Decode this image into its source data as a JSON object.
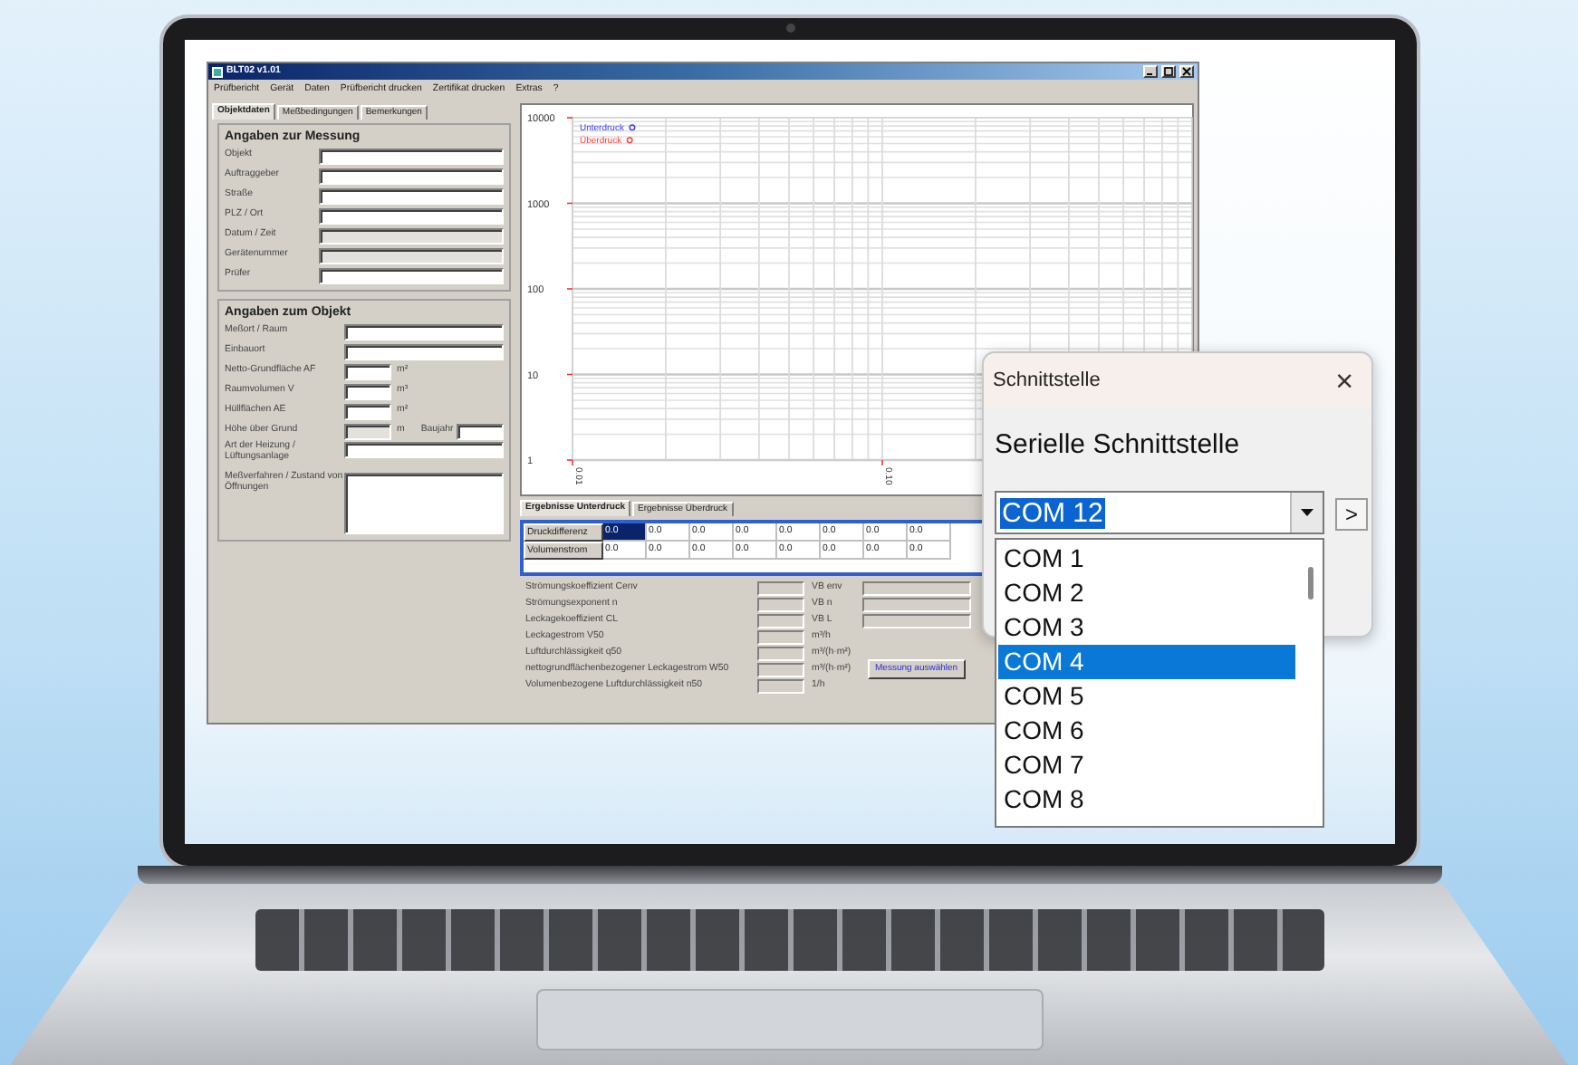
{
  "app": {
    "title": "BLT02 v1.01",
    "menu": [
      "Prüfbericht",
      "Gerät",
      "Daten",
      "Prüfbericht drucken",
      "Zertifikat drucken",
      "Extras",
      "?"
    ],
    "left_tabs": [
      {
        "label": "Objektdaten",
        "selected": true
      },
      {
        "label": "Meßbedingungen",
        "selected": false
      },
      {
        "label": "Bemerkungen",
        "selected": false
      }
    ],
    "groups": [
      {
        "title": "Angaben zur Messung",
        "fields": [
          {
            "kind": "text",
            "label": "Objekt",
            "disabled": false
          },
          {
            "kind": "text",
            "label": "Auftraggeber",
            "disabled": false
          },
          {
            "kind": "text",
            "label": "Straße",
            "disabled": false
          },
          {
            "kind": "text",
            "label": "PLZ / Ort",
            "disabled": false
          },
          {
            "kind": "text",
            "label": "Datum / Zeit",
            "disabled": true
          },
          {
            "kind": "text",
            "label": "Gerätenummer",
            "disabled": true
          },
          {
            "kind": "text",
            "label": "Prüfer",
            "disabled": false
          }
        ]
      },
      {
        "title": "Angaben zum Objekt",
        "fields": [
          {
            "kind": "text",
            "label": "Meßort / Raum",
            "disabled": false
          },
          {
            "kind": "text",
            "label": "Einbauort",
            "disabled": false
          },
          {
            "kind": "unit",
            "label": "Netto-Grundfläche AF",
            "unit": "m²",
            "disabled": false
          },
          {
            "kind": "unit",
            "label": "Raumvolumen V",
            "unit": "m³",
            "disabled": false
          },
          {
            "kind": "unit",
            "label": "Hüllflächen AE",
            "unit": "m²",
            "disabled": false
          },
          {
            "kind": "pair",
            "label": "Höhe über Grund",
            "unit": "m",
            "label2": "Baujahr",
            "disabled": true
          },
          {
            "kind": "text",
            "label": "Art der Heizung / Lüftungsanlage",
            "disabled": false
          },
          {
            "kind": "area",
            "label": "Meßverfahren / Zustand von Öffnungen",
            "disabled": false
          }
        ]
      }
    ],
    "chart": {
      "y_labels": [
        "10000",
        "1000",
        "100",
        "10",
        "1"
      ],
      "x_labels": [
        "0.01",
        "0.10"
      ],
      "legend": [
        {
          "label": "Unterdruck",
          "color": "#3a3aff"
        },
        {
          "label": "Überdruck",
          "color": "#ff3a3a"
        }
      ]
    },
    "result_tabs": [
      {
        "label": "Ergebnisse Unterdruck",
        "selected": true
      },
      {
        "label": "Ergebnisse Überdruck",
        "selected": false
      }
    ],
    "grid": [
      {
        "label": "Druckdifferenz",
        "cells": [
          {
            "text": "0.0",
            "selected": true
          },
          {
            "text": "0.0",
            "selected": false
          },
          {
            "text": "0.0",
            "selected": false
          },
          {
            "text": "0.0",
            "selected": false
          },
          {
            "text": "0.0",
            "selected": false
          },
          {
            "text": "0.0",
            "selected": false
          },
          {
            "text": "0.0",
            "selected": false
          },
          {
            "text": "0.0",
            "selected": false
          }
        ]
      },
      {
        "label": "Volumenstrom",
        "cells": [
          {
            "text": "0.0",
            "selected": false
          },
          {
            "text": "0.0",
            "selected": false
          },
          {
            "text": "0.0",
            "selected": false
          },
          {
            "text": "0.0",
            "selected": false
          },
          {
            "text": "0.0",
            "selected": false
          },
          {
            "text": "0.0",
            "selected": false
          },
          {
            "text": "0.0",
            "selected": false
          },
          {
            "text": "0.0",
            "selected": false
          }
        ]
      }
    ],
    "results": [
      {
        "kind": "paired",
        "label": "Strömungskoeffizient Cenv",
        "side": "VB env"
      },
      {
        "kind": "paired",
        "label": "Strömungsexponent n",
        "side": "VB n"
      },
      {
        "kind": "paired",
        "label": "Leckagekoeffizient CL",
        "side": "VB L"
      },
      {
        "kind": "unit",
        "label": "Leckagestrom V50",
        "side": "m³/h"
      },
      {
        "kind": "unit",
        "label": "Luftdurchlässigkeit q50",
        "side": "m³/(h·m²)"
      },
      {
        "kind": "unit",
        "label": "nettogrundflächenbezogener Leckagestrom W50",
        "side": "m³/(h·m²)"
      },
      {
        "kind": "unit",
        "label": "Volumenbezogene Luftdurchlässigkeit n50",
        "side": "1/h"
      }
    ],
    "select_button": "Messung auswählen"
  },
  "dialog": {
    "title": "Schnittstelle",
    "close": "×",
    "heading": "Serielle Schnittstelle",
    "value": "COM 12",
    "next": ">",
    "options": [
      {
        "label": "COM 1",
        "selected": false
      },
      {
        "label": "COM 2",
        "selected": false
      },
      {
        "label": "COM 3",
        "selected": false
      },
      {
        "label": "COM 4",
        "selected": true
      },
      {
        "label": "COM 5",
        "selected": false
      },
      {
        "label": "COM 6",
        "selected": false
      },
      {
        "label": "COM 7",
        "selected": false
      },
      {
        "label": "COM 8",
        "selected": false
      }
    ]
  }
}
